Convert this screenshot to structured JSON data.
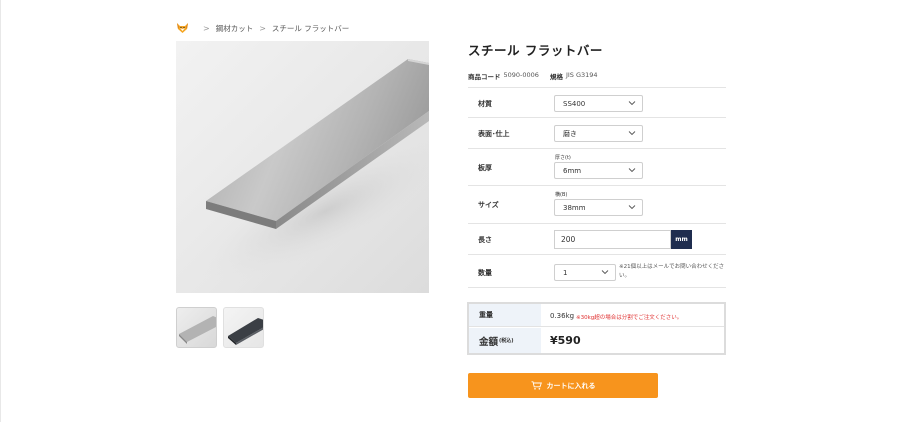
{
  "breadcrumb": {
    "items": [
      "鋼材カット",
      "スチール フラットバー"
    ],
    "separator": ">"
  },
  "product": {
    "title": "スチール フラットバー",
    "code_label": "商品コード",
    "code_value": "5090-0006",
    "standard_label": "規格",
    "standard_value": "JIS G3194"
  },
  "options": {
    "material": {
      "label": "材質",
      "value": "SS400"
    },
    "finish": {
      "label": "表面･仕上",
      "value": "磨き"
    },
    "thickness": {
      "label": "板厚",
      "sublabel": "厚さ(t)",
      "value": "6mm"
    },
    "size": {
      "label": "サイズ",
      "sublabel": "横(B)",
      "value": "38mm"
    },
    "length": {
      "label": "長さ",
      "value": "200",
      "unit": "mm"
    },
    "quantity": {
      "label": "数量",
      "value": "1",
      "note": "※21個以上はメールでお問い合わせください。"
    }
  },
  "summary": {
    "weight_label": "重量",
    "weight_value": "0.36kg",
    "weight_note": "※30kg超の場合は分割でご注文ください。",
    "price_label": "金額",
    "price_tax_label": "(税込)",
    "price_value": "¥590"
  },
  "cart": {
    "label": "カートに入れる"
  },
  "icons": {
    "logo": "fox-logo-icon",
    "chevron": "chevron-down-icon",
    "cart": "cart-icon"
  },
  "colors": {
    "accent": "#f7941d",
    "unit_bg": "#1f2d4f",
    "warning": "#e03030",
    "price_head_bg": "#eef3f9"
  }
}
